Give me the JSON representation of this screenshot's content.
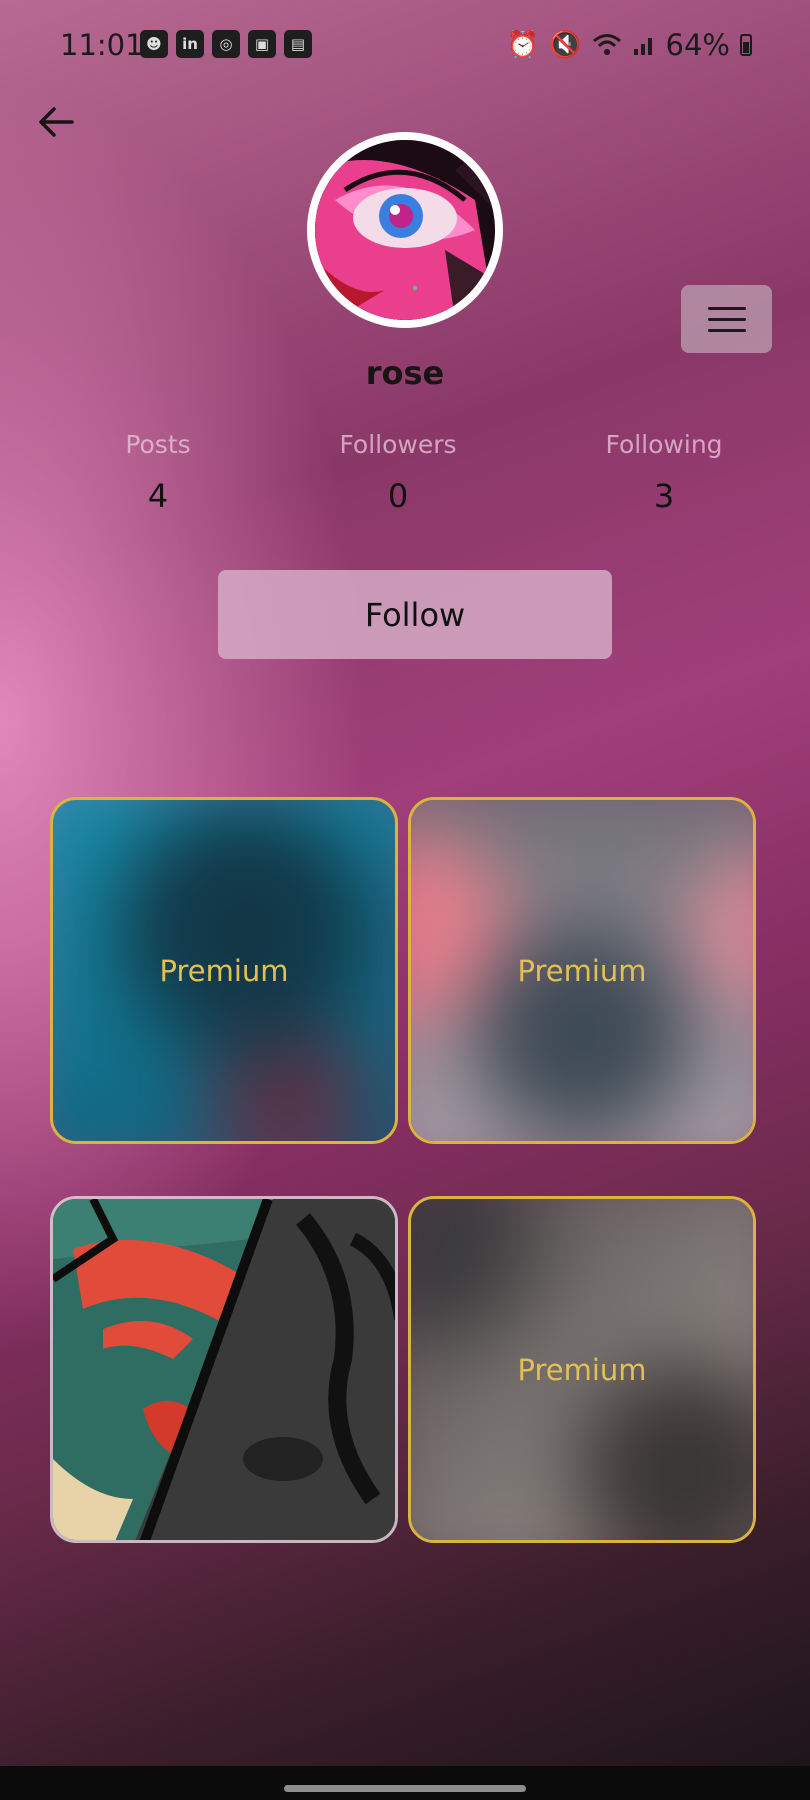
{
  "status_bar": {
    "time": "11:01",
    "left_icons": [
      "discord-icon",
      "linkedin-icon",
      "instagram-icon",
      "gallery-icon",
      "screen-cast-icon"
    ],
    "right_icons": [
      "alarm-icon",
      "mute-icon",
      "wifi-icon",
      "signal-icon"
    ],
    "battery": "64%"
  },
  "profile": {
    "username": "rose",
    "stats": [
      {
        "label": "Posts",
        "value": "4"
      },
      {
        "label": "Followers",
        "value": "0"
      },
      {
        "label": "Following",
        "value": "3"
      }
    ],
    "follow_label": "Follow"
  },
  "posts": [
    {
      "premium": true,
      "label": "Premium"
    },
    {
      "premium": true,
      "label": "Premium"
    },
    {
      "premium": false,
      "label": ""
    },
    {
      "premium": true,
      "label": "Premium"
    }
  ],
  "colors": {
    "premium_border": "#d9b440",
    "premium_text": "#e3c052",
    "follow_button": "#d7afc8"
  }
}
